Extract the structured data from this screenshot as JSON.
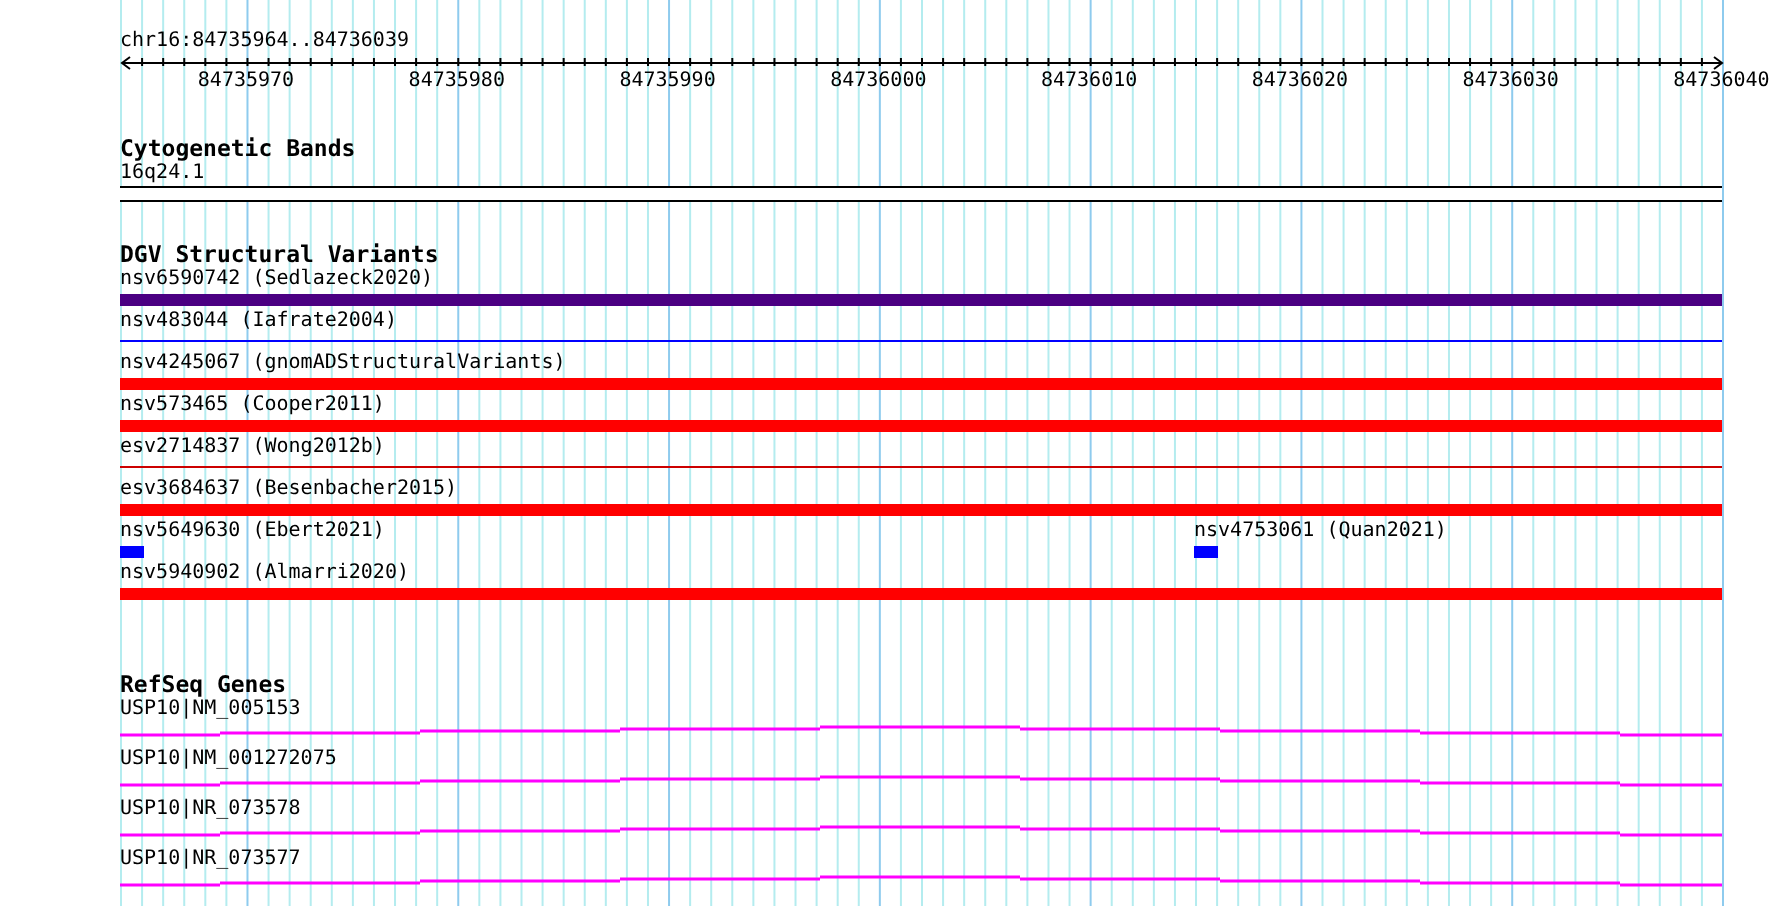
{
  "ruler": {
    "location": "chr16:84735964..84736039",
    "tick_labels": [
      "84735970",
      "84735980",
      "84735990",
      "84736000",
      "84736010",
      "84736020",
      "84736030",
      "84736040"
    ]
  },
  "cytogenetic_bands": {
    "title": "Cytogenetic Bands",
    "band_label": "16q24.1"
  },
  "dgv_structural_variants": {
    "title": "DGV Structural Variants",
    "rows": [
      {
        "features": [
          {
            "label": "nsv6590742 (Sedlazeck2020)",
            "kind": "thick",
            "color": "#4b0082"
          }
        ]
      },
      {
        "features": [
          {
            "label": "nsv483044 (Iafrate2004)",
            "kind": "thin",
            "color": "#0000ff"
          }
        ]
      },
      {
        "features": [
          {
            "label": "nsv4245067 (gnomADStructuralVariants)",
            "kind": "thick",
            "color": "#ff0000"
          }
        ]
      },
      {
        "features": [
          {
            "label": "nsv573465 (Cooper2011)",
            "kind": "thick",
            "color": "#ff0000"
          }
        ]
      },
      {
        "features": [
          {
            "label": "esv2714837 (Wong2012b)",
            "kind": "thin",
            "color": "#cc0000"
          }
        ]
      },
      {
        "features": [
          {
            "label": "esv3684637 (Besenbacher2015)",
            "kind": "thick",
            "color": "#ff0000"
          }
        ]
      },
      {
        "features": [
          {
            "label": "nsv5649630 (Ebert2021)",
            "kind": "block",
            "color": "#0000ff"
          },
          {
            "label": "nsv4753061 (Quan2021)",
            "kind": "block",
            "color": "#0000ff"
          }
        ]
      },
      {
        "features": [
          {
            "label": "nsv5940902 (Almarri2020)",
            "kind": "thick",
            "color": "#ff0000"
          }
        ]
      }
    ]
  },
  "refseq_genes": {
    "title": "RefSeq Genes",
    "genes": [
      {
        "label": "USP10|NM_005153"
      },
      {
        "label": "USP10|NM_001272075"
      },
      {
        "label": "USP10|NR_073578"
      },
      {
        "label": "USP10|NR_073577"
      }
    ]
  }
}
